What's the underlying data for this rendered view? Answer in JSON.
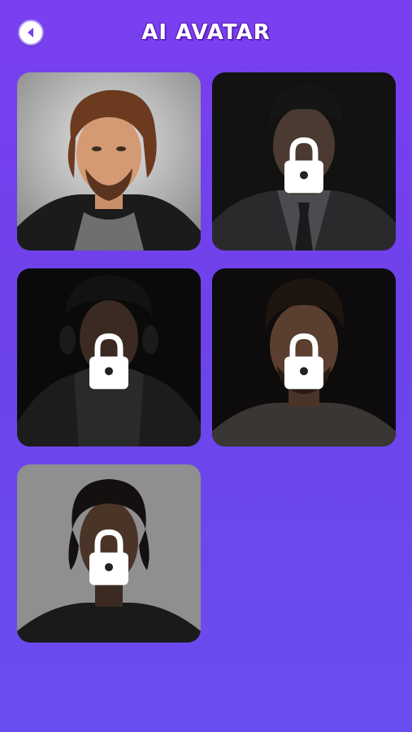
{
  "header": {
    "title": "AI AVATAR",
    "back_icon": "back-arrow-icon"
  },
  "avatars": [
    {
      "id": "avatar-1",
      "locked": false,
      "background": "#bdbdbd"
    },
    {
      "id": "avatar-2",
      "locked": true,
      "background": "#111111"
    },
    {
      "id": "avatar-3",
      "locked": true,
      "background": "#0a0a0a"
    },
    {
      "id": "avatar-4",
      "locked": true,
      "background": "#0d0b0b"
    },
    {
      "id": "avatar-5",
      "locked": true,
      "background": "#8f8f8f"
    }
  ],
  "colors": {
    "background_top": "#7a3ff0",
    "background_bottom": "#6a4df0",
    "lock": "#ffffff"
  }
}
